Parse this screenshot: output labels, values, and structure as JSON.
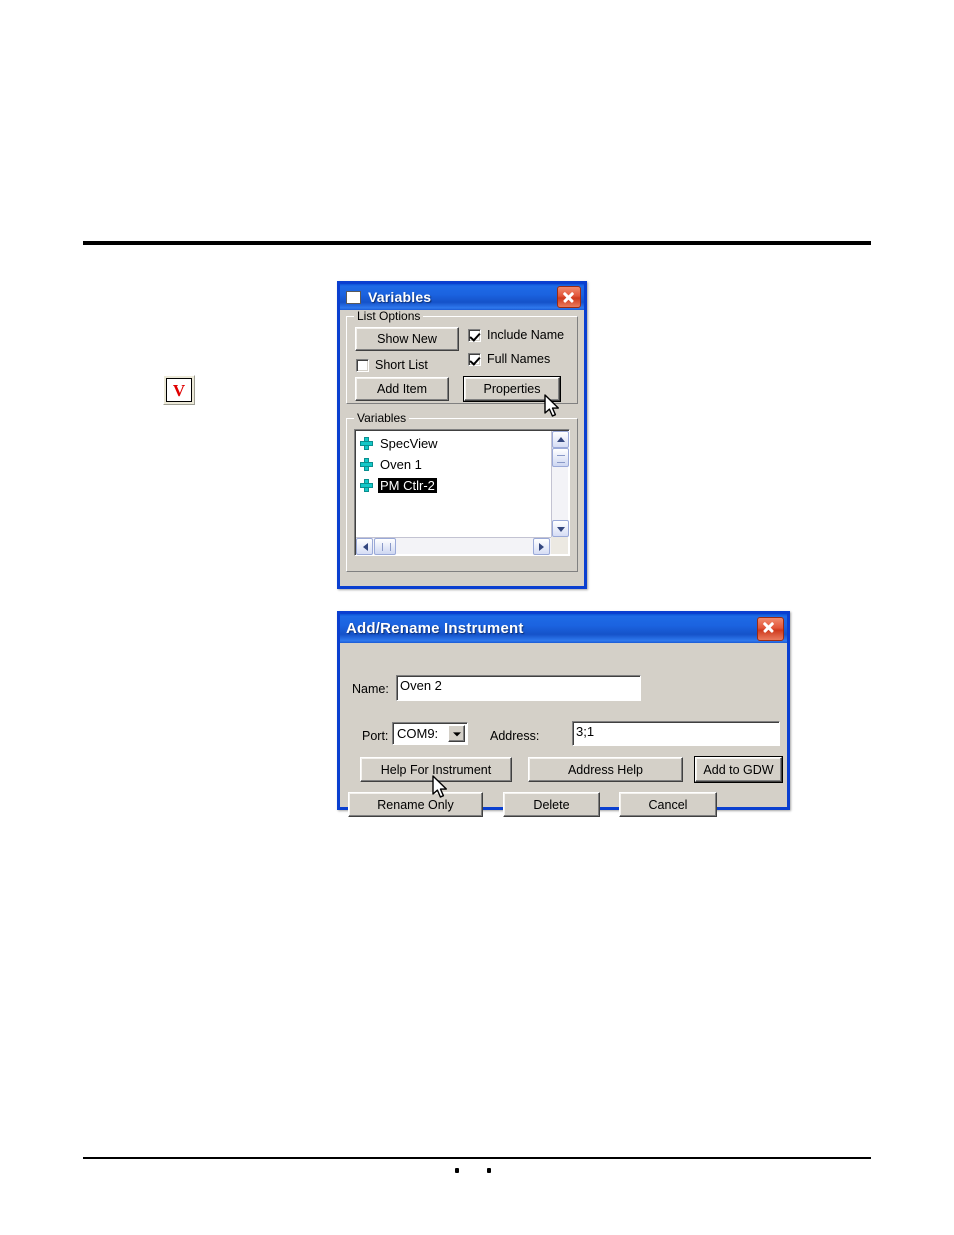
{
  "page": {
    "footer_marks": "• •"
  },
  "toolbar_icon": {
    "name": "variables-toolbar-icon",
    "glyph": "V",
    "color": "#e00000"
  },
  "variables_dialog": {
    "title": "Variables",
    "close_label": "✕",
    "list_options": {
      "legend": "List Options",
      "show_new_button": "Show New",
      "short_list_checkbox": "Short List",
      "short_list_checked": false,
      "add_item_button": "Add Item",
      "include_name_checkbox": "Include Name",
      "include_name_checked": true,
      "full_names_checkbox": "Full Names",
      "full_names_checked": true,
      "properties_button": "Properties"
    },
    "variables_group": {
      "legend": "Variables",
      "items": [
        {
          "label": "SpecView",
          "selected": false
        },
        {
          "label": "Oven 1",
          "selected": false
        },
        {
          "label": "PM Ctlr-2",
          "selected": true
        }
      ]
    }
  },
  "instrument_dialog": {
    "title": "Add/Rename Instrument",
    "close_label": "✕",
    "name_label": "Name:",
    "name_value": "Oven 2",
    "port_label": "Port:",
    "port_value": "COM9:",
    "address_label": "Address:",
    "address_value": "3;1",
    "help_for_instrument_button": "Help For Instrument",
    "address_help_button": "Address Help",
    "add_to_gdw_button": "Add to GDW",
    "rename_only_button": "Rename Only",
    "delete_button": "Delete",
    "cancel_button": "Cancel"
  },
  "colors": {
    "titlebar_blue": "#1552c9",
    "dialog_face": "#d4d0c8",
    "dialog_border": "#0a3fd0",
    "close_red": "#cf3a1d",
    "plus_icon": "#15c8c8",
    "selection": "#000000"
  }
}
